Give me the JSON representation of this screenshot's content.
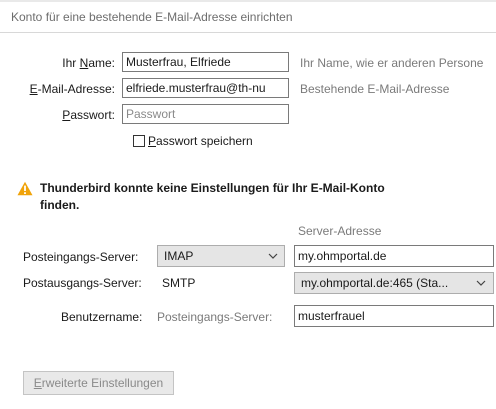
{
  "dialog": {
    "title": "Konto für eine bestehende E-Mail-Adresse einrichten"
  },
  "form": {
    "name_label_pre": "Ihr ",
    "name_label_ul": "N",
    "name_label_post": "ame:",
    "name_value": "Musterfrau, Elfriede",
    "name_hint": "Ihr Name, wie er anderen Persone",
    "email_label_ul": "E",
    "email_label_post": "-Mail-Adresse:",
    "email_value": "elfriede.musterfrau@th-nu",
    "email_hint": "Bestehende E-Mail-Adresse",
    "password_label_ul": "P",
    "password_label_post": "asswort:",
    "password_placeholder": "Passwort",
    "remember_ul": "P",
    "remember_post": "asswort speichern",
    "remember_checked": false
  },
  "warning": {
    "icon": "warning-triangle-icon",
    "icon_color": "#f0a30a",
    "line1": "Thunderbird konnte keine Einstellungen für Ihr E-Mail-Konto",
    "line2": "finden."
  },
  "server": {
    "column_header": "Server-Adresse",
    "incoming_label": "Posteingangs-Server:",
    "incoming_protocol": "IMAP",
    "incoming_address": "my.ohmportal.de",
    "outgoing_label": "Postausgangs-Server:",
    "outgoing_protocol": "SMTP",
    "outgoing_server": "my.ohmportal.de:465 (Sta...",
    "username_label": "Benutzername:",
    "username_sublabel": "Posteingangs-Server:",
    "username_value": "musterfrauel"
  },
  "buttons": {
    "advanced_ul": "E",
    "advanced_post": "rweiterte Einstellungen"
  }
}
